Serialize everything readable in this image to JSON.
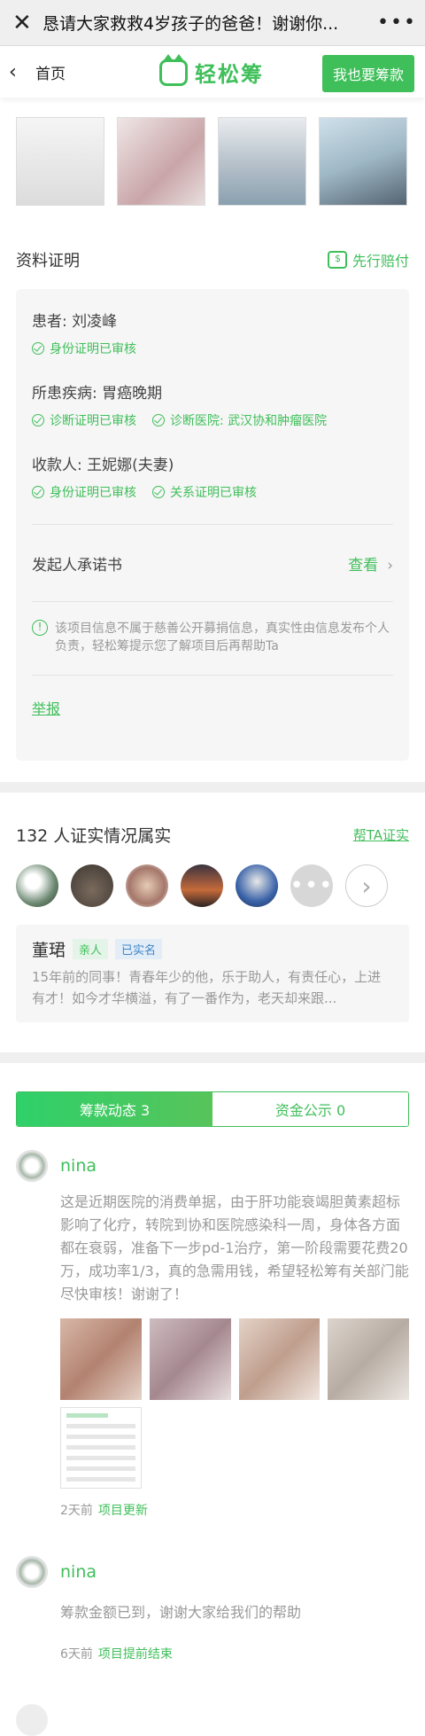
{
  "topbar": {
    "close_icon": "close-icon",
    "title": "恳请大家救救4岁孩子的爸爸！谢谢你...",
    "more_icon": "more-icon"
  },
  "navbar": {
    "back_label": "首页",
    "brand": "轻松筹",
    "cta": "我也要筹款",
    "accent": "#3fbf5a"
  },
  "verification": {
    "title": "资料证明",
    "guarantee": "先行赔付",
    "patient": {
      "label": "患者: 刘凌峰",
      "tags": [
        "身份证明已审核"
      ]
    },
    "disease": {
      "label": "所患疾病: 胃癌晚期",
      "tags": [
        "诊断证明已审核",
        "诊断医院: 武汉协和肿瘤医院"
      ]
    },
    "payee": {
      "label": "收款人: 王妮娜(夫妻)",
      "tags": [
        "身份证明已审核",
        "关系证明已审核"
      ]
    },
    "promise": {
      "label": "发起人承诺书",
      "link": "查看"
    },
    "notice": "该项目信息不属于慈善公开募捐信息，真实性由信息发布个人负责，轻松筹提示您了解项目后再帮助Ta",
    "report": "举报"
  },
  "witness": {
    "title": "132 人证实情况属实",
    "link": "帮TA证实",
    "comment": {
      "name": "董珺",
      "badge_relation": "亲人",
      "badge_verified": "已实名",
      "text": "15年前的同事！青春年少的他，乐于助人，有责任心，上进有才！如今才华横溢，有了一番作为，老天却来跟..."
    }
  },
  "tabs": {
    "updates": "筹款动态 3",
    "funds": "资金公示 0"
  },
  "updates": [
    {
      "name": "nina",
      "text": "这是近期医院的消费单据，由于肝功能衰竭胆黄素超标影响了化疗，转院到协和医院感染科一周，身体各方面都在衰弱，准备下一步pd-1治疗，第一阶段需要花费20万，成功率1/3，真的急需用钱，希望轻松筹有关部门能尽快审核！谢谢了！",
      "time": "2天前",
      "type": "项目更新"
    },
    {
      "name": "nina",
      "text": "筹款金额已到，谢谢大家给我们的帮助",
      "time": "6天前",
      "type": "项目提前结束"
    }
  ]
}
